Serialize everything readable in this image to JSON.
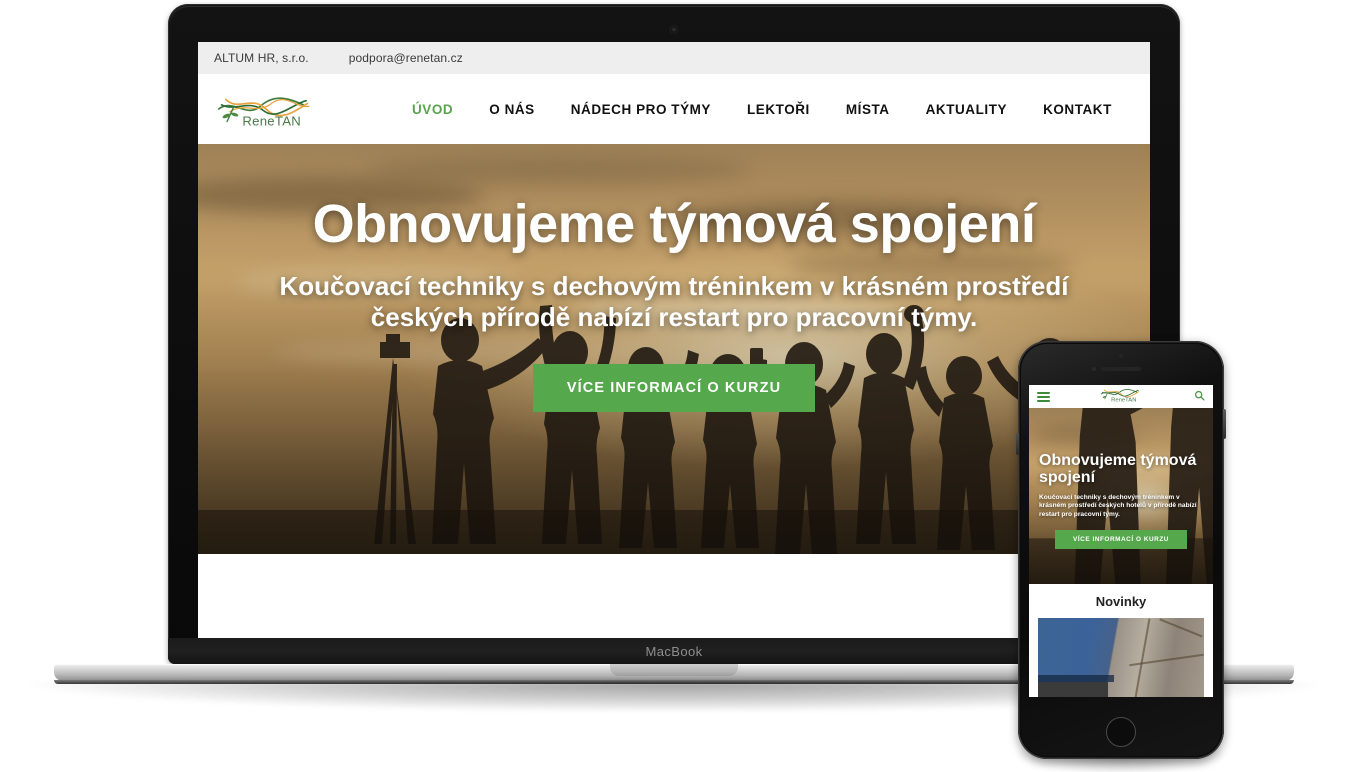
{
  "device_labels": {
    "laptop_wordmark": "MacBook"
  },
  "site": {
    "topbar": {
      "company": "ALTUM HR, s.r.o.",
      "email": "podpora@renetan.cz"
    },
    "logo": {
      "text": "ReneTAN",
      "icon": "renetan-waves-logo",
      "colors": {
        "green": "#3f7d3f",
        "orange": "#e8a33d",
        "text": "#4a7a4a"
      }
    },
    "nav": {
      "items": [
        {
          "label": "ÚVOD",
          "active": true
        },
        {
          "label": "O NÁS",
          "active": false
        },
        {
          "label": "NÁDECH PRO TÝMY",
          "active": false
        },
        {
          "label": "LEKTOŘI",
          "active": false
        },
        {
          "label": "MÍSTA",
          "active": false
        },
        {
          "label": "AKTUALITY",
          "active": false
        },
        {
          "label": "KONTAKT",
          "active": false
        }
      ],
      "search_icon": "search-icon"
    },
    "hero": {
      "title": "Obnovujeme týmová spojení",
      "subtitle": "Koučovací techniky s dechovým tréninkem v krásném prostředí českých přírodě nabízí restart pro pracovní týmy.",
      "cta_label": "VÍCE INFORMACÍ O KURZU",
      "cta_color": "#56a84d",
      "background": "sunset-silhouette-team-photo"
    }
  },
  "mobile": {
    "header": {
      "menu_icon": "hamburger-menu-icon",
      "search_icon": "search-icon"
    },
    "hero": {
      "title": "Obnovujeme týmová spojení",
      "subtitle": "Koučovací techniky s dechovým tréninkem v krásném prostředí českých hotelů v přírodě nabízí restart pro pracovní týmy.",
      "cta_label": "VÍCE INFORMACÍ O KURZU"
    },
    "news": {
      "title": "Novinky",
      "image": "blue-jacket-on-stone-photo"
    }
  }
}
